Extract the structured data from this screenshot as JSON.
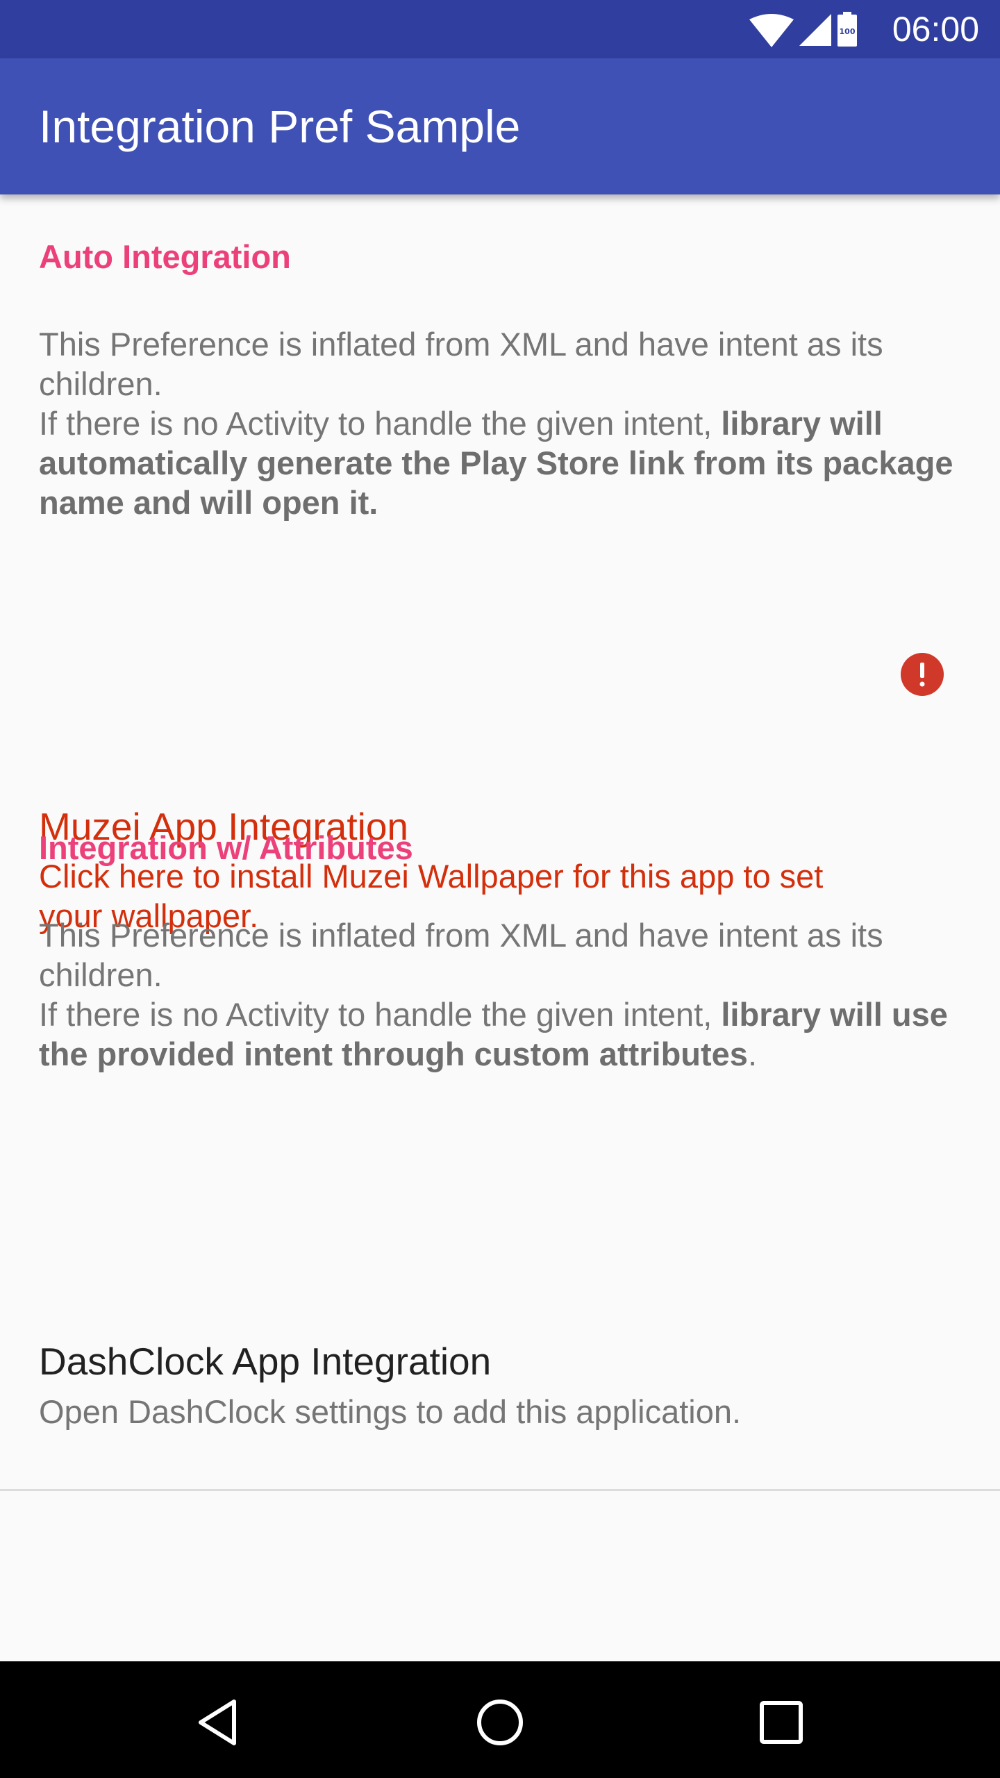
{
  "status_bar": {
    "time": "06:00",
    "battery_level": "100",
    "icons": [
      "wifi-icon",
      "signal-icon",
      "battery-icon"
    ]
  },
  "app_bar": {
    "title": "Integration Pref Sample"
  },
  "sections": {
    "auto": {
      "header": "Auto Integration",
      "desc_line1": "This Preference is inflated from XML and have intent as its children.",
      "desc_line2_prefix": "If there is no Activity to handle the given intent, ",
      "desc_line2_bold": "library will automatically generate the Play Store link from its package name and will open it."
    },
    "muzei": {
      "title": "Muzei App Integration",
      "summary": "Click here to install Muzei Wallpaper for this app to set your wallpaper.",
      "status_icon": "alert-icon"
    },
    "attributes": {
      "header": "Integration w/ Attributes",
      "desc_line1": "This Preference is inflated from XML and have intent as its children.",
      "desc_line2_prefix": "If there is no Activity to handle the given intent, ",
      "desc_line2_bold": "library will use the provided intent through custom attributes",
      "desc_line2_suffix": "."
    },
    "dashclock": {
      "title": "DashClock App Integration",
      "summary": "Open DashClock settings to add this application."
    }
  },
  "nav_bar": {
    "buttons": [
      "back-icon",
      "home-icon",
      "recents-icon"
    ]
  },
  "colors": {
    "status_bar": "#303F9F",
    "app_bar": "#3F51B5",
    "category_accent": "#EC407A",
    "error_text": "#D32F0C",
    "error_icon": "#D0382A",
    "background": "#FAFAFA"
  }
}
